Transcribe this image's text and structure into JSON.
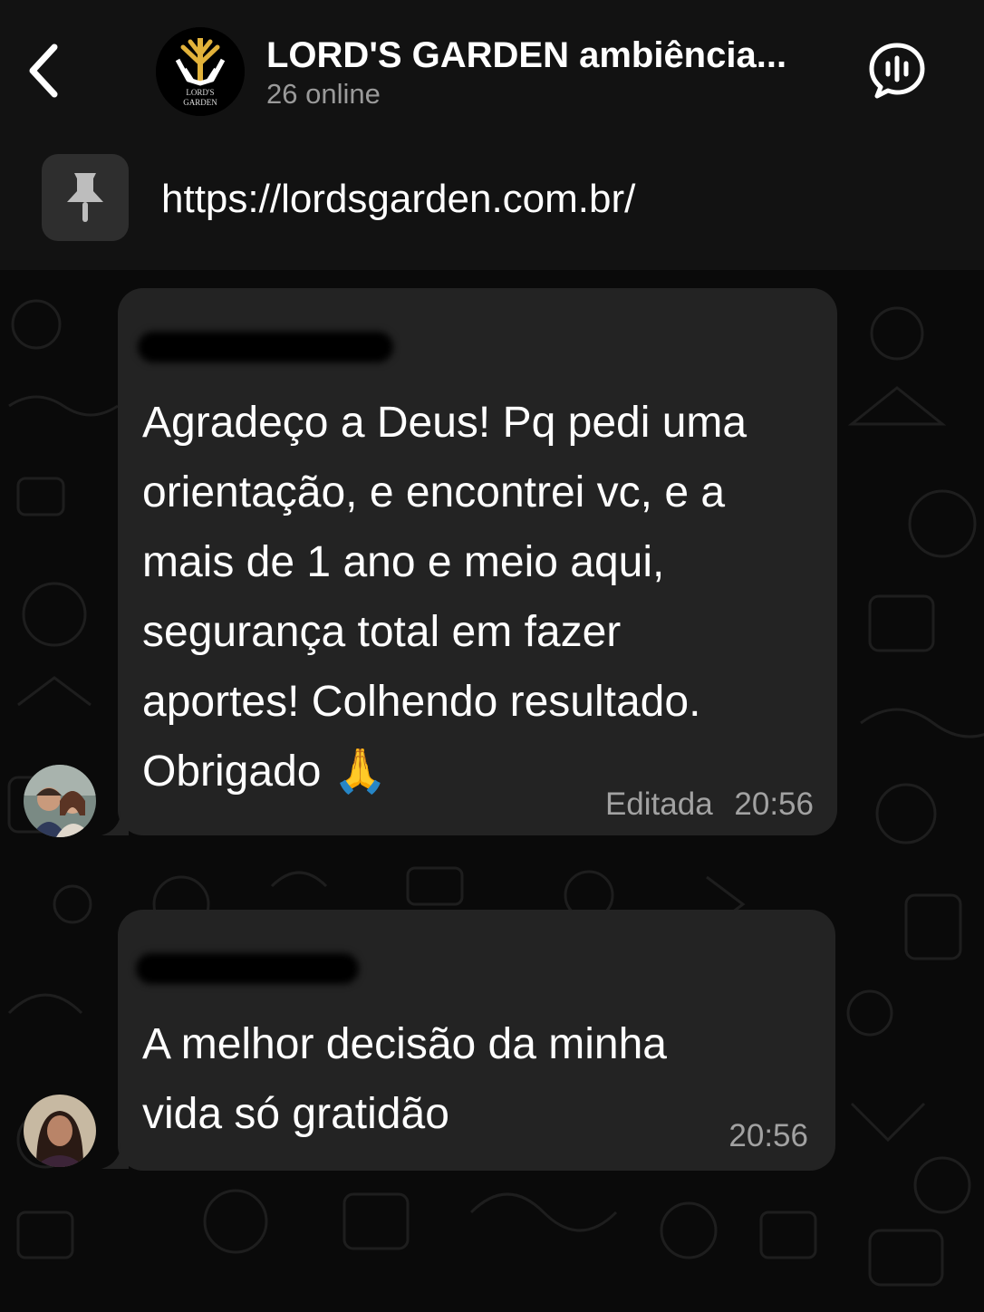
{
  "header": {
    "back_icon": "chevron-left-icon",
    "title": "LORD'S GARDEN ambiência...",
    "subtitle": "26 online",
    "logo_text_line1": "LORD'S",
    "logo_text_line2": "GARDEN",
    "voice_icon": "voice-chat-icon"
  },
  "pinned": {
    "icon": "pin-icon",
    "text": "https://lordsgarden.com.br/"
  },
  "messages": [
    {
      "sender_redacted": true,
      "text_lines": [
        "Agradeço a Deus! Pq pedi uma",
        "orientação, e encontrei vc, e a",
        "mais de 1 ano e meio aqui,",
        "segurança total em fazer",
        "aportes! Colhendo resultado.",
        "Obrigado 🙏"
      ],
      "edited_label": "Editada",
      "time": "20:56"
    },
    {
      "sender_redacted": true,
      "text_lines": [
        "A melhor decisão da minha",
        "vida só gratidão"
      ],
      "time": "20:56"
    }
  ],
  "colors": {
    "header_bg": "#121212",
    "bubble_bg": "#232323",
    "chat_bg": "#0a0a0a",
    "logo_gold": "#e2b23a",
    "subtitle": "#9a9a9a"
  }
}
